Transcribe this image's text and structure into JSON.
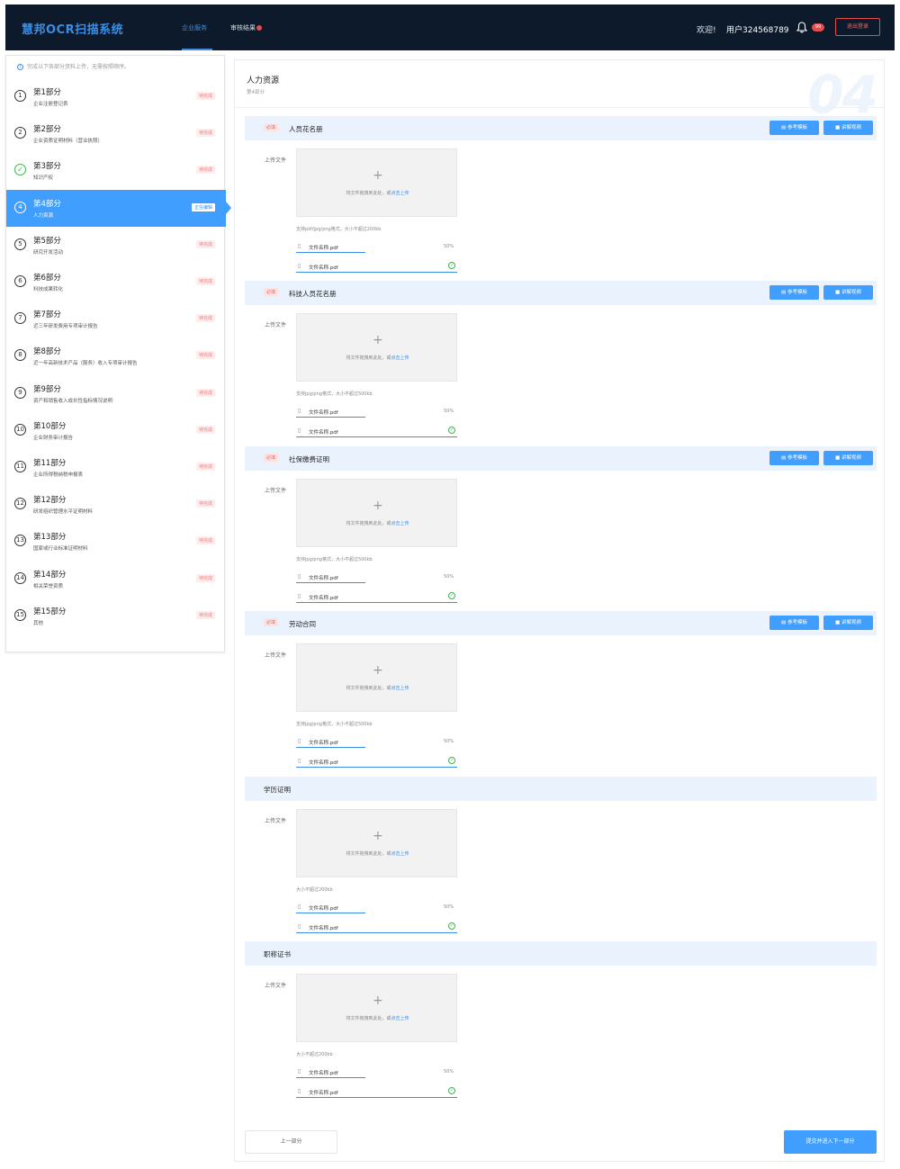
{
  "header": {
    "logo": "慧邦OCR扫描系统",
    "nav": [
      {
        "label": "企业服务",
        "active": true
      },
      {
        "label": "审核结果",
        "dot": true
      }
    ],
    "welcome": "欢迎!",
    "username": "用户324568789",
    "notification_count": "99",
    "logout_label": "退出登录"
  },
  "sidebar": {
    "tip": "完成以下各部分资料上传，无需按照顺序。",
    "steps": [
      {
        "num": "1",
        "title": "第1部分",
        "desc": "企业注册登记表",
        "status": "待完成"
      },
      {
        "num": "2",
        "title": "第2部分",
        "desc": "企业资质证明材料（营业执照）",
        "status": "待完成"
      },
      {
        "num": "✓",
        "title": "第3部分",
        "desc": "知识产权",
        "status": "待完成",
        "done": true
      },
      {
        "num": "4",
        "title": "第4部分",
        "desc": "人力资源",
        "status": "正在编辑",
        "active": true
      },
      {
        "num": "5",
        "title": "第5部分",
        "desc": "研究开发活动",
        "status": "待完成"
      },
      {
        "num": "6",
        "title": "第6部分",
        "desc": "科技成果转化",
        "status": "待完成"
      },
      {
        "num": "7",
        "title": "第7部分",
        "desc": "近三年研发费用专项审计报告",
        "status": "待完成"
      },
      {
        "num": "8",
        "title": "第8部分",
        "desc": "近一年高新技术产品（服务）收入专项审计报告",
        "status": "待完成"
      },
      {
        "num": "9",
        "title": "第9部分",
        "desc": "资产和销售收入成长性指标情况说明",
        "status": "待完成"
      },
      {
        "num": "10",
        "title": "第10部分",
        "desc": "企业财务审计报告",
        "status": "待完成"
      },
      {
        "num": "11",
        "title": "第11部分",
        "desc": "企业所得税纳税申报表",
        "status": "待完成"
      },
      {
        "num": "12",
        "title": "第12部分",
        "desc": "研发组织管理水平证明材料",
        "status": "待完成"
      },
      {
        "num": "13",
        "title": "第13部分",
        "desc": "国家或行业标准证明材料",
        "status": "待完成"
      },
      {
        "num": "14",
        "title": "第14部分",
        "desc": "相关荣誉资质",
        "status": "待完成"
      },
      {
        "num": "15",
        "title": "第15部分",
        "desc": "其他",
        "status": "待完成"
      }
    ]
  },
  "main": {
    "title": "人力资源",
    "subtitle": "第4部分",
    "watermark": "04",
    "required_label": "必填",
    "template_btn": "参考模板",
    "video_btn": "讲解视频",
    "upload_label": "上传文件",
    "drop_text": "将文件拖拽到此处，或",
    "drop_link": "点击上传",
    "file_name": "文件名称.pdf",
    "file_pct": "50%",
    "sections": [
      {
        "name": "人员花名册",
        "required": true,
        "hint": "支持pdf/jpg/png格式，大小不超过200kb"
      },
      {
        "name": "科技人员花名册",
        "required": true,
        "hint": "支持jpg/png格式，大小不超过500kb"
      },
      {
        "name": "社保缴费证明",
        "required": true,
        "hint": "支持jpg/png格式，大小不超过500kb"
      },
      {
        "name": "劳动合同",
        "required": true,
        "hint": "支持jpg/png格式，大小不超过500kb"
      },
      {
        "name": "学历证明",
        "required": false,
        "hint": "大小不超过200kb"
      },
      {
        "name": "职称证书",
        "required": false,
        "hint": "大小不超过200kb"
      }
    ],
    "prev_label": "上一部分",
    "next_label": "提交并进入下一部分"
  }
}
